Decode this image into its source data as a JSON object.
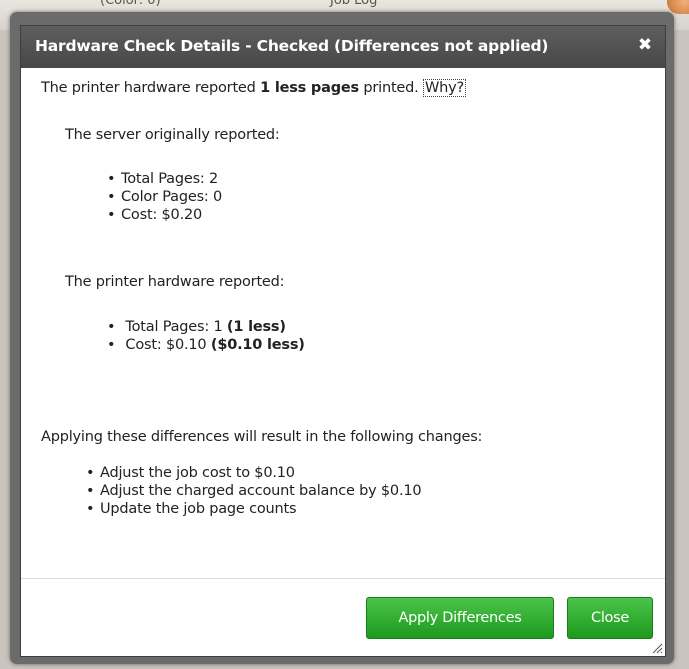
{
  "background": {
    "text_left": "(Color: 0)",
    "text_mid": "Job Log"
  },
  "dialog": {
    "title": "Hardware Check Details - Checked (Differences not applied)",
    "close_glyph": "✖",
    "intro": {
      "prefix": "The printer hardware reported",
      "bold": "1 less pages",
      "suffix": "printed.",
      "link": "Why?"
    },
    "server": {
      "heading": "The server originally reported:",
      "items": [
        "Total Pages: 2",
        "Color Pages: 0",
        "Cost: $0.20"
      ]
    },
    "printer": {
      "heading": "The printer hardware reported:",
      "items": [
        {
          "text": "Total Pages: 1",
          "bold": "(1 less)"
        },
        {
          "text": "Cost: $0.10",
          "bold": "($0.10 less)"
        }
      ]
    },
    "changes": {
      "heading": "Applying these differences will result in the following changes:",
      "items": [
        "Adjust the job cost to $0.10",
        "Adjust the charged account balance by $0.10",
        "Update the job page counts"
      ]
    },
    "buttons": {
      "apply": "Apply Differences",
      "close": "Close"
    }
  },
  "colors": {
    "title_bar": "#4f4f4f",
    "button_green": "#2aa82a"
  }
}
